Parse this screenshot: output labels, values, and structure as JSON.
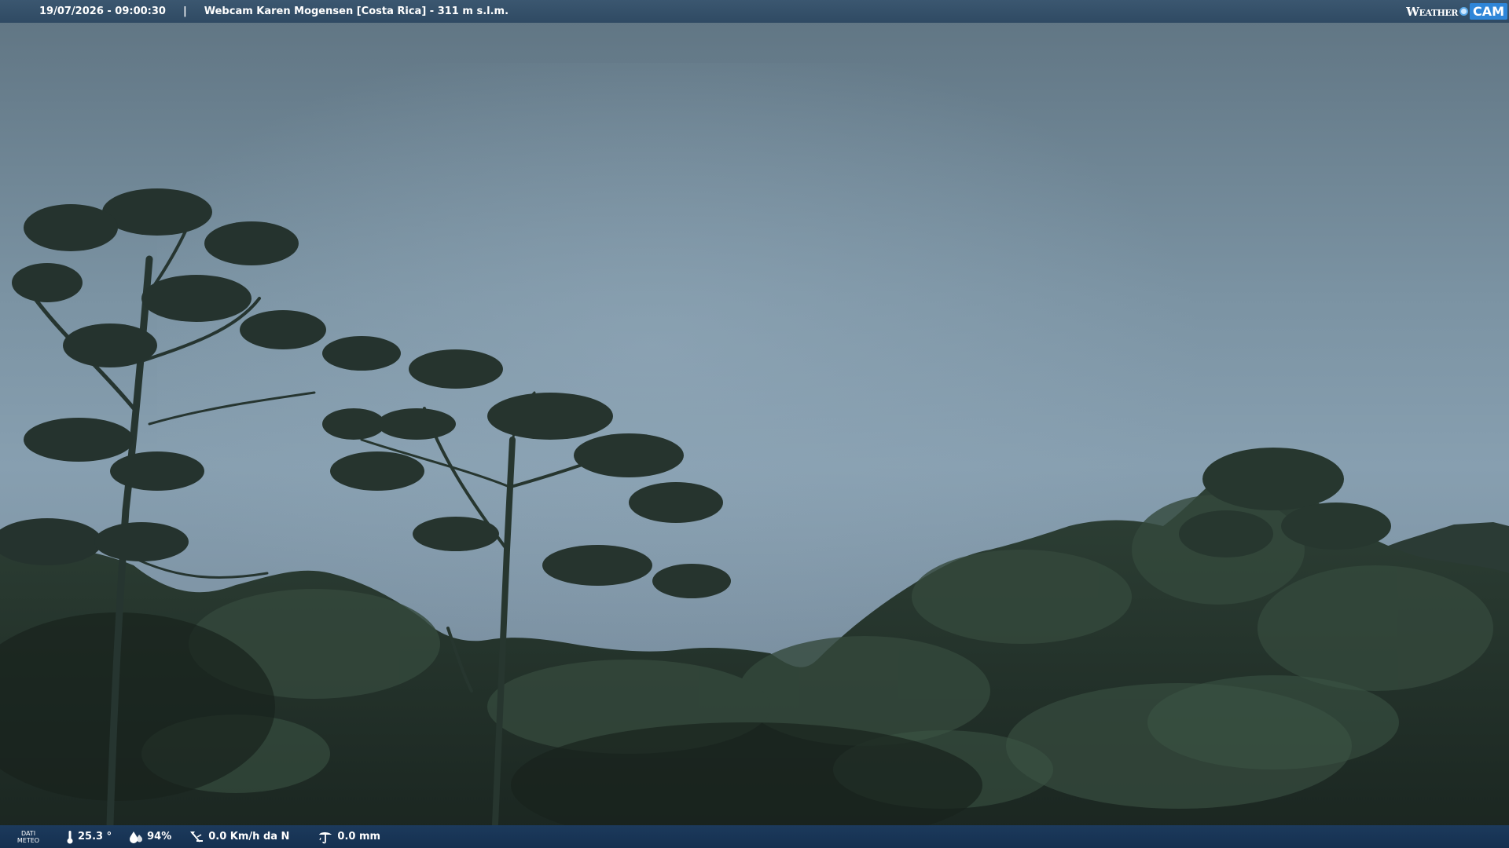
{
  "header": {
    "datetime": "19/07/2026 - 09:00:30",
    "separator": "|",
    "location": "Webcam Karen Mogensen [Costa Rica]  - 311 m s.l.m.",
    "logo_text_a": "Weather",
    "logo_text_b": "CAM"
  },
  "footer": {
    "dati_line1": "DATI",
    "dati_line2": "METEO",
    "temperature": "25.3 °",
    "humidity": "94%",
    "wind": "0.0 Km/h da N",
    "rain": "0.0 mm"
  },
  "icons": {
    "temperature": "thermometer-icon",
    "humidity": "humidity-drop-icon",
    "wind": "wind-vane-icon",
    "rain": "rain-gauge-icon"
  },
  "colors": {
    "sky_top": "#5f7482",
    "sky_mid": "#8da3b3",
    "forest_dark": "#1e2b26",
    "forest_mid": "#2c3e33",
    "bar_top": "#34506a",
    "bar_bottom": "#173454"
  }
}
